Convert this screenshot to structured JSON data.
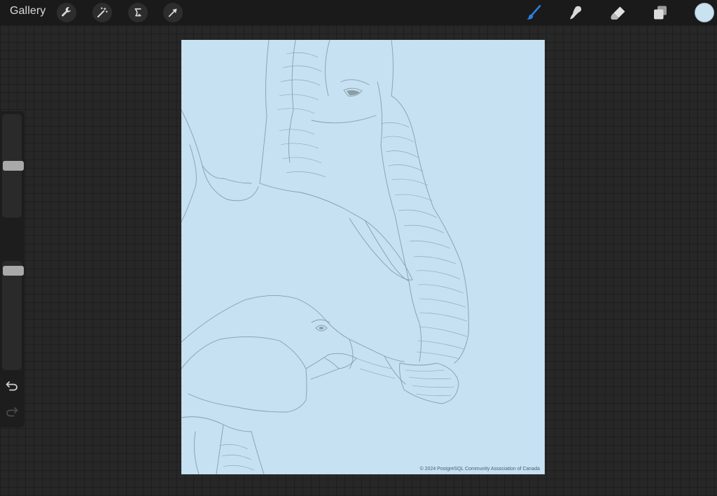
{
  "toolbar": {
    "gallery_label": "Gallery",
    "left_tools": [
      {
        "icon": "wrench-icon"
      },
      {
        "icon": "magic-wand-icon"
      },
      {
        "icon": "selection-icon"
      },
      {
        "icon": "transform-arrow-icon"
      }
    ],
    "right_tools": [
      {
        "icon": "brush-icon",
        "active": true
      },
      {
        "icon": "smudge-icon"
      },
      {
        "icon": "eraser-icon"
      },
      {
        "icon": "layers-icon"
      }
    ],
    "current_color": "#c8e2f2"
  },
  "sidebar": {
    "brush_size_level": 0.5,
    "opacity_level": 0.95,
    "undo_icon": "undo-icon",
    "redo_icon": "redo-icon"
  },
  "canvas": {
    "background_color": "#c5e1f2",
    "sketch_color": "#8a9ea8",
    "copyright": "© 2024 PostgreSQL Community Association of Canada"
  },
  "colors": {
    "accent": "#2a7fe0",
    "toolbar_bg": "#1a1a1a",
    "workspace_bg": "#272727"
  }
}
